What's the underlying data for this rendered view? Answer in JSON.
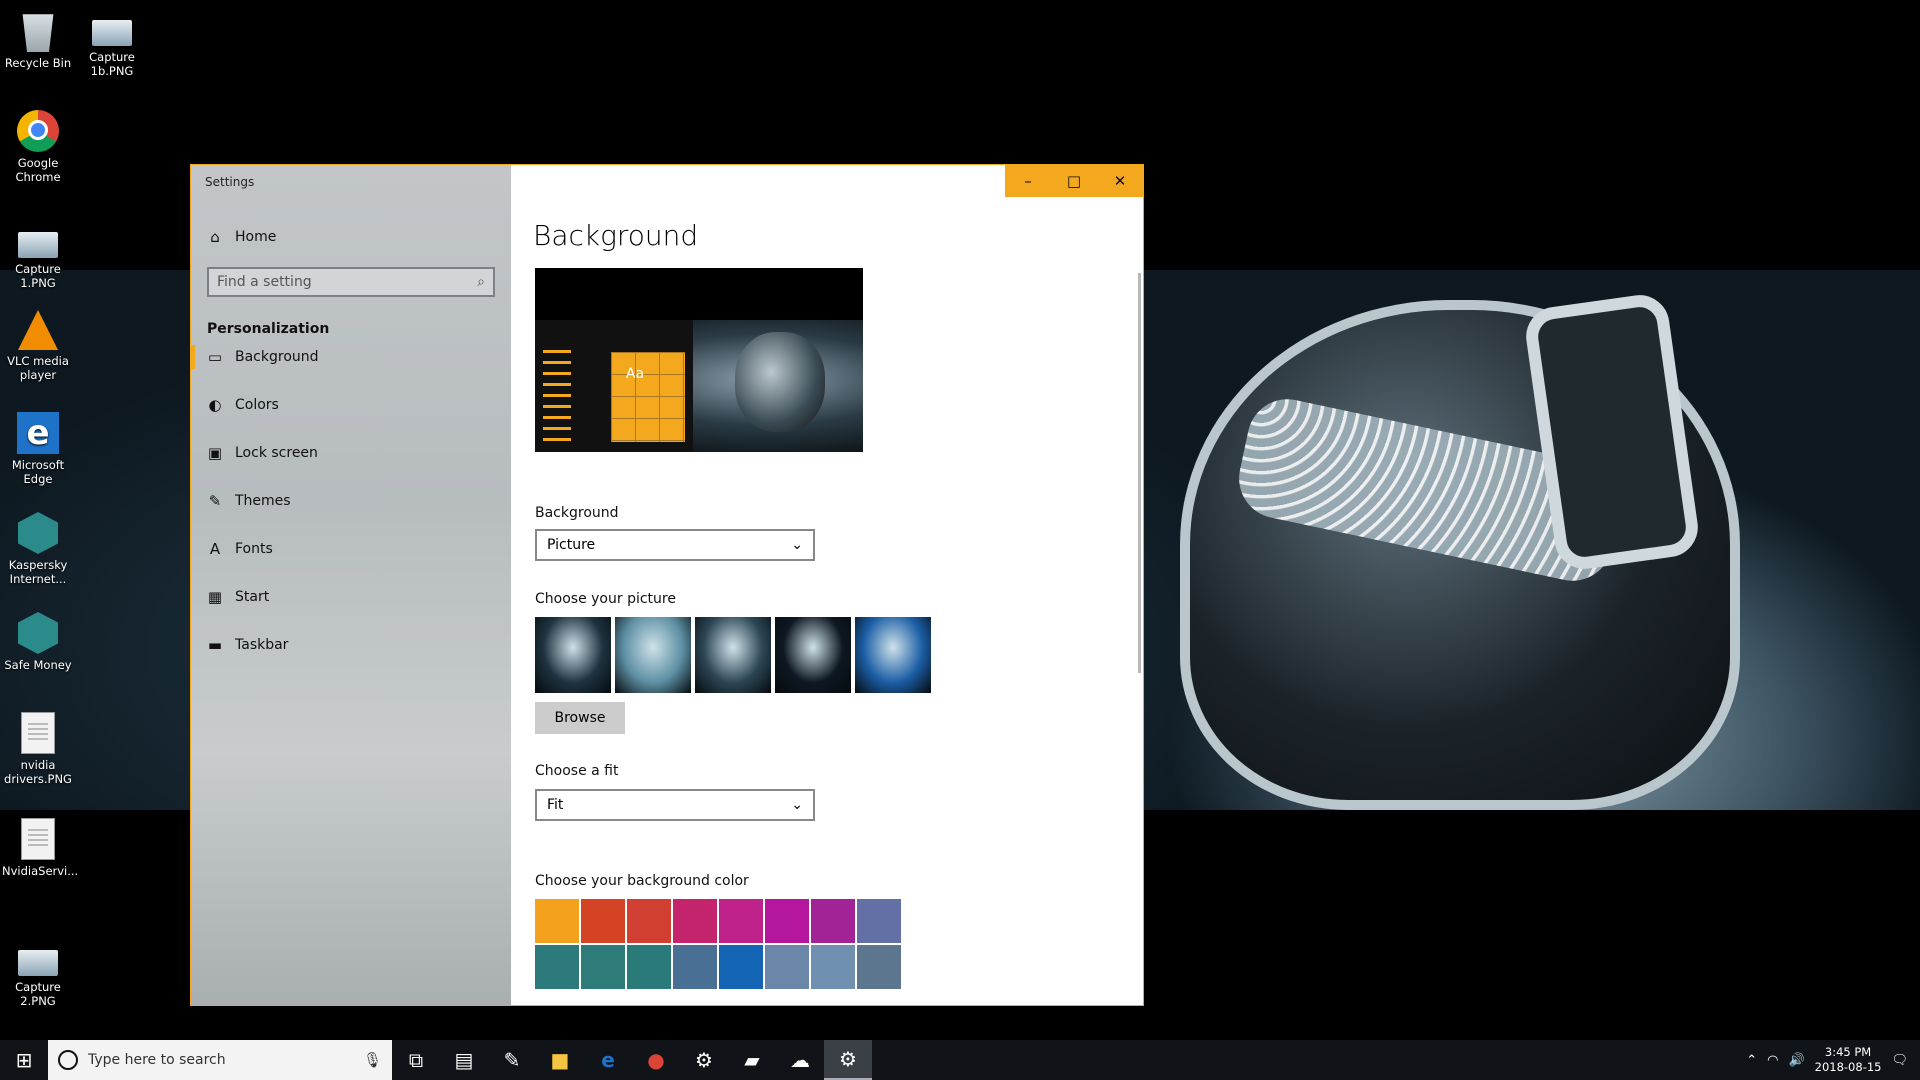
{
  "desktop": {
    "icons": [
      {
        "label": "Recycle Bin"
      },
      {
        "label": "Capture 1b.PNG"
      },
      {
        "label": "Google Chrome"
      },
      {
        "label": "Capture 1.PNG"
      },
      {
        "label": "VLC media player"
      },
      {
        "label": "Microsoft Edge"
      },
      {
        "label": "Kaspersky Internet..."
      },
      {
        "label": "Safe Money"
      },
      {
        "label": "nvidia drivers.PNG"
      },
      {
        "label": "NvidiaServi..."
      },
      {
        "label": "Capture 2.PNG"
      }
    ]
  },
  "window": {
    "title": "Settings",
    "nav": {
      "home": "Home",
      "search_placeholder": "Find a setting",
      "group": "Personalization",
      "items": [
        {
          "label": "Background",
          "icon": "picture-icon",
          "glyph": "▭"
        },
        {
          "label": "Colors",
          "icon": "palette-icon",
          "glyph": "◐"
        },
        {
          "label": "Lock screen",
          "icon": "lock-screen-icon",
          "glyph": "▣"
        },
        {
          "label": "Themes",
          "icon": "themes-icon",
          "glyph": "✎"
        },
        {
          "label": "Fonts",
          "icon": "fonts-icon",
          "glyph": "A"
        },
        {
          "label": "Start",
          "icon": "start-icon",
          "glyph": "▦"
        },
        {
          "label": "Taskbar",
          "icon": "taskbar-icon",
          "glyph": "▬"
        }
      ]
    },
    "content": {
      "page_title": "Background",
      "preview_tile_text": "Aa",
      "background_label": "Background",
      "background_value": "Picture",
      "choose_picture_label": "Choose your picture",
      "browse_label": "Browse",
      "fit_label": "Choose a fit",
      "fit_value": "Fit",
      "bg_color_label": "Choose your background color",
      "swatches": [
        [
          "#f4a11d",
          "#d44424",
          "#d13f33",
          "#c3246c",
          "#c0228b",
          "#b4179e",
          "#a12395",
          "#6270a6"
        ],
        [
          "#2c7b7a",
          "#2d7c79",
          "#2a7a79",
          "#4a6f95",
          "#1464b4",
          "#6a86a8",
          "#6f90b0",
          "#5d7690"
        ]
      ],
      "thumbs": [
        "#1e3340",
        "#5d8fa3",
        "#2c4655",
        "#0e1822",
        "#1b5ea5"
      ]
    }
  },
  "taskbar": {
    "search_placeholder": "Type here to search",
    "time": "3:45 PM",
    "date": "2018-08-15",
    "accent": "#f4a81d"
  }
}
